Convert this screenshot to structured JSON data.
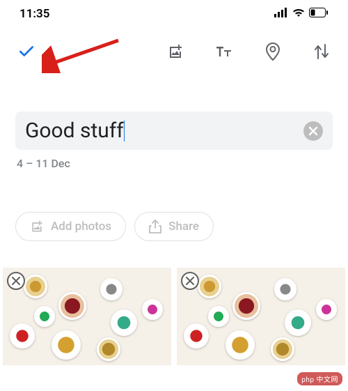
{
  "status": {
    "time": "11:35",
    "signal": "signal-icon",
    "wifi": "wifi-icon",
    "battery": "battery-low-icon"
  },
  "toolbar": {
    "confirm": "check-icon",
    "add_image": "add-image-icon",
    "text_style": "text-style-icon",
    "location": "location-icon",
    "sort": "sort-icon"
  },
  "title": {
    "value": "Good stuff",
    "clear": "clear-icon"
  },
  "date_range": "4 – 11 Dec",
  "actions": {
    "add_photos": {
      "label": "Add photos",
      "icon": "add-image-icon"
    },
    "share": {
      "label": "Share",
      "icon": "share-icon"
    }
  },
  "photos": [
    {
      "remove": "remove-icon",
      "alt": "decorative plates on wall"
    },
    {
      "remove": "remove-icon",
      "alt": "decorative plates on wall"
    }
  ],
  "watermark": "php 中文网"
}
